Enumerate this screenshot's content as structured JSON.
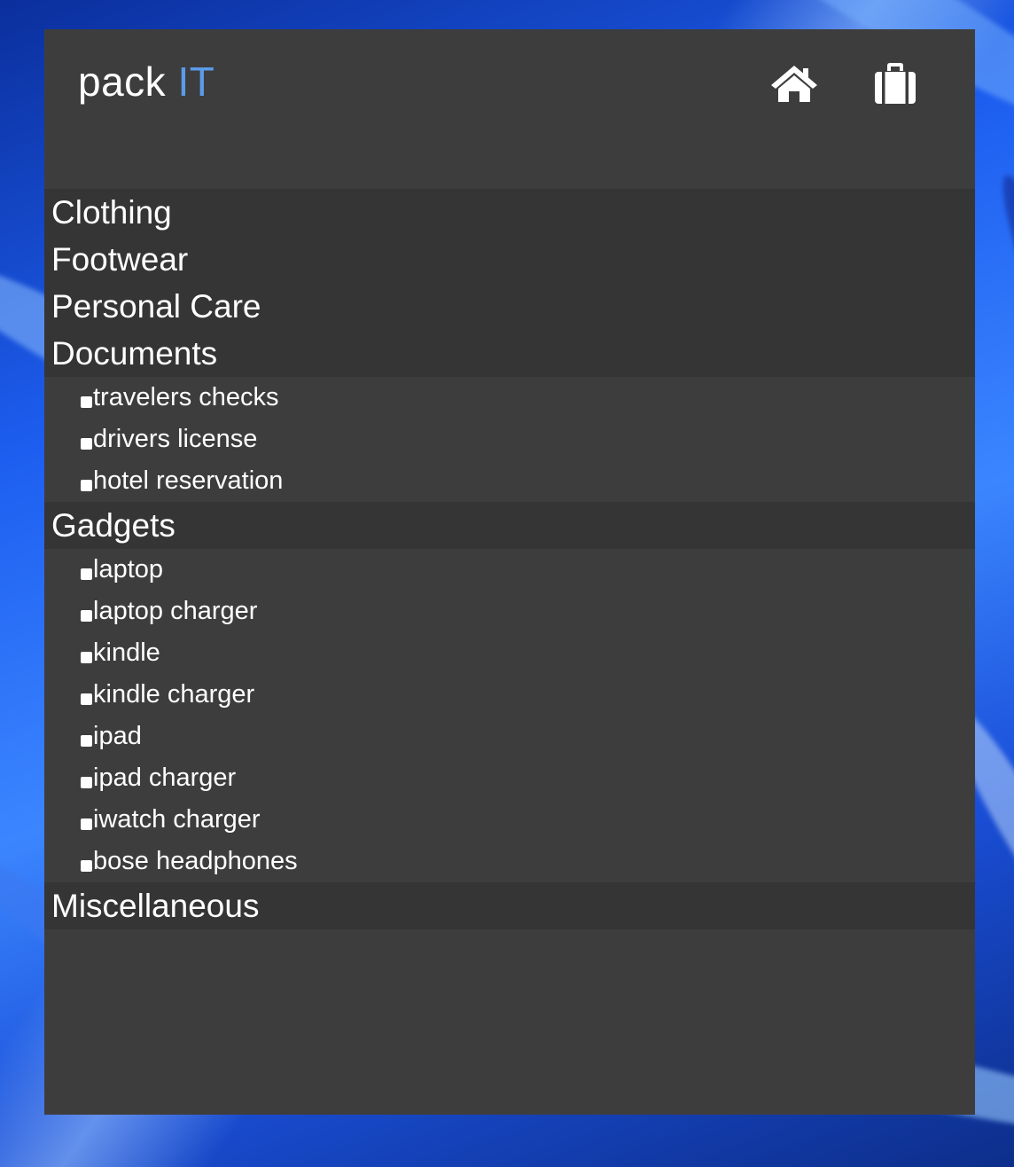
{
  "app": {
    "logo_main": "pack",
    "logo_accent": "IT",
    "accent_color": "#5b9be8"
  },
  "nav": {
    "home_icon": "home-icon",
    "luggage_icon": "suitcase-icon"
  },
  "categories": {
    "clothing": "Clothing",
    "footwear": "Footwear",
    "personal_care": "Personal Care",
    "documents": "Documents",
    "gadgets": "Gadgets",
    "miscellaneous": "Miscellaneous"
  },
  "documents_items": [
    "travelers checks",
    "drivers license",
    "hotel reservation"
  ],
  "gadgets_items": [
    "laptop",
    "laptop charger",
    "kindle",
    "kindle charger",
    "ipad",
    "ipad charger",
    "iwatch charger",
    "bose headphones"
  ]
}
